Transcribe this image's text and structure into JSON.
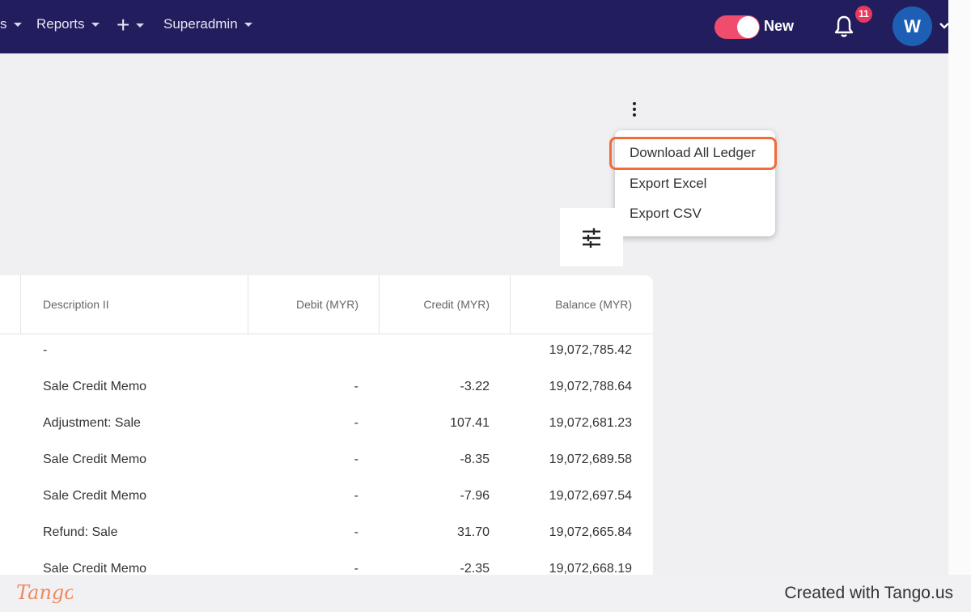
{
  "nav": {
    "left_fragment": "s",
    "reports": "Reports",
    "superadmin": "Superadmin",
    "toggle_label": "New",
    "notification_count": "11",
    "avatar_initial": "W"
  },
  "menu": {
    "items": [
      "Download All Ledger",
      "Export Excel",
      "Export CSV"
    ]
  },
  "table": {
    "headers": [
      "Description II",
      "Debit (MYR)",
      "Credit (MYR)",
      "Balance (MYR)"
    ],
    "rows": [
      {
        "description": "-",
        "debit": "",
        "credit": "",
        "balance": "19,072,785.42"
      },
      {
        "description": "Sale Credit Memo",
        "debit": "-",
        "credit": "-3.22",
        "balance": "19,072,788.64"
      },
      {
        "description": "Adjustment: Sale",
        "debit": "-",
        "credit": "107.41",
        "balance": "19,072,681.23"
      },
      {
        "description": "Sale Credit Memo",
        "debit": "-",
        "credit": "-8.35",
        "balance": "19,072,689.58"
      },
      {
        "description": "Sale Credit Memo",
        "debit": "-",
        "credit": "-7.96",
        "balance": "19,072,697.54"
      },
      {
        "description": "Refund: Sale",
        "debit": "-",
        "credit": "31.70",
        "balance": "19,072,665.84"
      },
      {
        "description": "Sale Credit Memo",
        "debit": "-",
        "credit": "-2.35",
        "balance": "19,072,668.19"
      }
    ]
  },
  "footer": {
    "logo_text": "Tango",
    "created": "Created with Tango.us"
  },
  "colors": {
    "nav_bg": "#221d5c",
    "toggle_on": "#f04d6e",
    "highlight": "#f26b38",
    "avatar_bg": "#1d5fb4"
  }
}
